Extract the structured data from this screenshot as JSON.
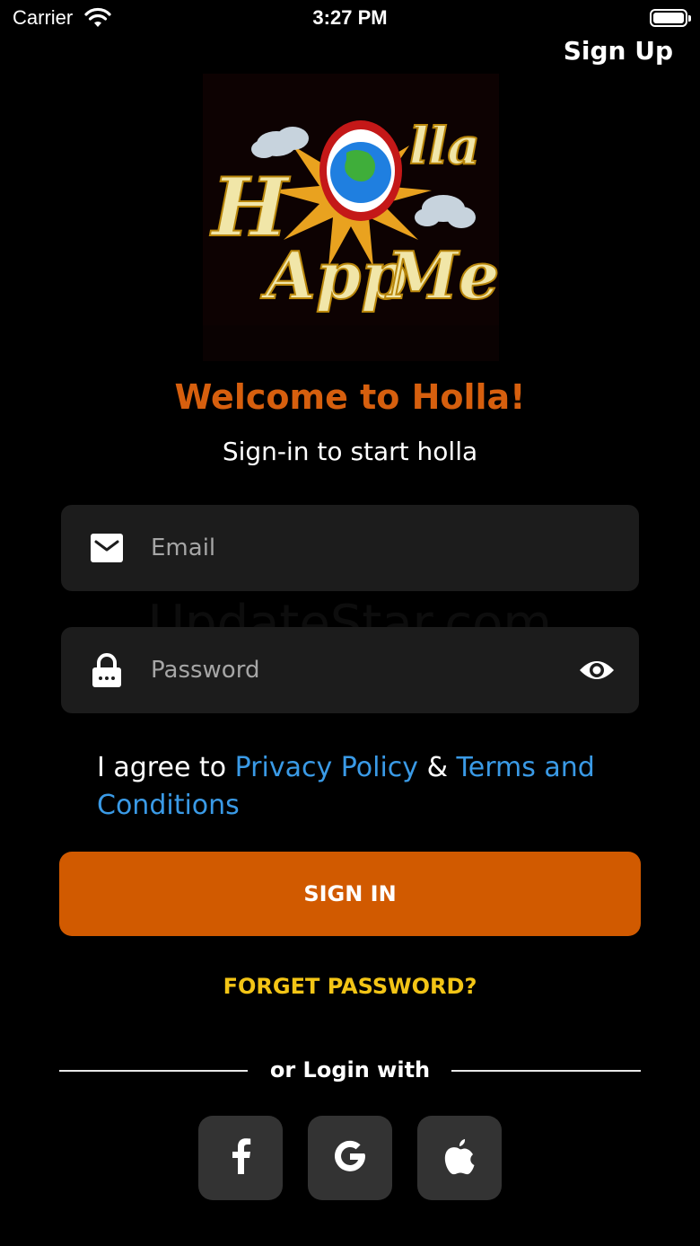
{
  "status_bar": {
    "carrier": "Carrier",
    "time": "3:27 PM"
  },
  "header": {
    "signup_label": "Sign Up"
  },
  "welcome": {
    "title": "Welcome to Holla!",
    "subtitle": "Sign-in to start holla"
  },
  "form": {
    "email_placeholder": "Email",
    "email_value": "",
    "password_placeholder": "Password",
    "password_value": ""
  },
  "watermark": "UpdateStar.com",
  "agreement": {
    "prefix": "I agree to ",
    "privacy_label": "Privacy Policy",
    "joiner": " & ",
    "terms_label": "Terms and Conditions"
  },
  "signin_label": "SIGN IN",
  "forget_label": "FORGET PASSWORD?",
  "social": {
    "divider_text": "or Login with",
    "buttons": [
      {
        "icon": "facebook-icon"
      },
      {
        "icon": "google-icon"
      },
      {
        "icon": "apple-icon"
      }
    ]
  },
  "colors": {
    "accent": "#d15a00",
    "welcome": "#d65f0e",
    "link": "#3a9ae6",
    "forget": "#f3c516",
    "field_bg": "#1c1c1c",
    "social_bg": "#333333"
  }
}
